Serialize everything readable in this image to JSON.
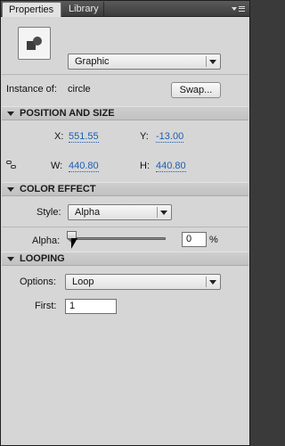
{
  "tabs": [
    {
      "label": "Properties",
      "active": true
    },
    {
      "label": "Library",
      "active": false
    }
  ],
  "symbol": {
    "icon": "graphic-symbol-icon",
    "type_select": "Graphic"
  },
  "instance": {
    "label": "Instance of:",
    "name": "circle",
    "swap_button": "Swap..."
  },
  "position_size": {
    "title": "POSITION AND SIZE",
    "x_label": "X:",
    "x_value": "551.55",
    "y_label": "Y:",
    "y_value": "-13.00",
    "w_label": "W:",
    "w_value": "440.80",
    "h_label": "H:",
    "h_value": "440.80"
  },
  "color_effect": {
    "title": "COLOR EFFECT",
    "style_label": "Style:",
    "style_value": "Alpha",
    "alpha_label": "Alpha:",
    "alpha_value": "0",
    "alpha_unit": "%",
    "alpha_fraction": 0.0
  },
  "looping": {
    "title": "LOOPING",
    "options_label": "Options:",
    "options_value": "Loop",
    "first_label": "First:",
    "first_value": "1"
  },
  "colors": {
    "panel_bg": "#d6d6d6",
    "tabbar_bg": "#4a4a4a",
    "hot_text": "#1a5fb4"
  }
}
